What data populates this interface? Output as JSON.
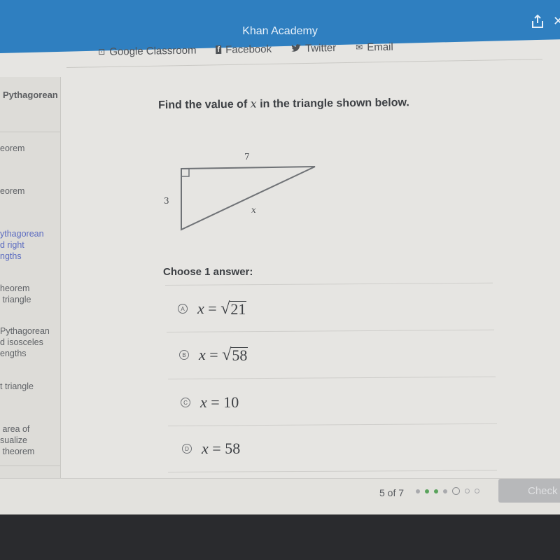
{
  "header": {
    "title": "Khan Academy",
    "icons": [
      "share-icon",
      "close-icon"
    ]
  },
  "share": {
    "links": [
      {
        "label": "Google Classroom",
        "icon": "google-classroom-icon",
        "glyph": "⊡"
      },
      {
        "label": "Facebook",
        "icon": "facebook-icon",
        "glyph": "f"
      },
      {
        "label": "Twitter",
        "icon": "twitter-icon",
        "glyph": "🐦"
      },
      {
        "label": "Email",
        "icon": "email-icon",
        "glyph": "✉"
      }
    ]
  },
  "sidebar": {
    "heading": "Pythagorean",
    "items": [
      {
        "label": "eorem",
        "active": false
      },
      {
        "label": "eorem",
        "active": false
      },
      {
        "label": "ythagorean\nd right\nngths",
        "active": true
      },
      {
        "label": "heorem\n triangle",
        "active": false
      },
      {
        "label": "Pythagorean\nd isosceles\nengths",
        "active": false
      },
      {
        "label": "t triangle",
        "active": false
      },
      {
        "label": " area of\nsualize\n theorem",
        "active": false
      }
    ]
  },
  "question": {
    "prefix": "Find the value of ",
    "variable": "x",
    "suffix": " in the triangle shown below."
  },
  "figure": {
    "labels": {
      "top": "7",
      "left": "3",
      "hypotenuse": "x"
    },
    "right_angle": "top-left"
  },
  "answers": {
    "prompt": "Choose 1 answer:",
    "choices": [
      {
        "letter": "A",
        "lhs": "x",
        "op": "=",
        "sqrt": true,
        "value": "21"
      },
      {
        "letter": "B",
        "lhs": "x",
        "op": "=",
        "sqrt": true,
        "value": "58"
      },
      {
        "letter": "C",
        "lhs": "x",
        "op": "=",
        "sqrt": false,
        "value": "10"
      },
      {
        "letter": "D",
        "lhs": "x",
        "op": "=",
        "sqrt": false,
        "value": "58"
      }
    ]
  },
  "footer": {
    "progress_text": "5 of 7",
    "current": 5,
    "total": 7,
    "dots": [
      "done-gray",
      "done-green",
      "done-green",
      "done-gray",
      "current",
      "todo",
      "todo"
    ],
    "check_label": "Check",
    "colors": {
      "correct": "#5aa35c",
      "header": "#2f7fc0"
    }
  }
}
